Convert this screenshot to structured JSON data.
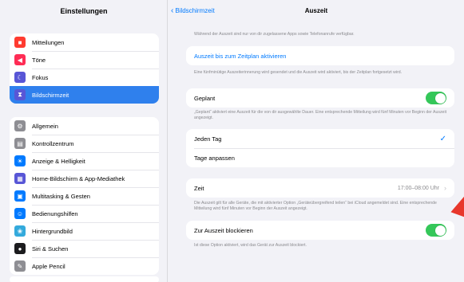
{
  "sidebar": {
    "title": "Einstellungen",
    "group1": [
      {
        "label": "Mitteilungen",
        "icon": "bell-icon",
        "glyph": "■",
        "color": "#ff3b30"
      },
      {
        "label": "Töne",
        "icon": "speaker-icon",
        "glyph": "◀",
        "color": "#ff2d55"
      },
      {
        "label": "Fokus",
        "icon": "moon-icon",
        "glyph": "☾",
        "color": "#5856d6"
      },
      {
        "label": "Bildschirmzeit",
        "icon": "hourglass-icon",
        "glyph": "⧗",
        "color": "#5856d6",
        "active": true
      }
    ],
    "group2": [
      {
        "label": "Allgemein",
        "icon": "gear-icon",
        "glyph": "⚙",
        "color": "#8e8e93"
      },
      {
        "label": "Kontrollzentrum",
        "icon": "control-center-icon",
        "glyph": "▤",
        "color": "#8e8e93"
      },
      {
        "label": "Anzeige & Helligkeit",
        "icon": "sun-icon",
        "glyph": "☀",
        "color": "#007aff"
      },
      {
        "label": "Home-Bildschirm & App-Mediathek",
        "icon": "home-grid-icon",
        "glyph": "▦",
        "color": "#5856d6"
      },
      {
        "label": "Multitasking & Gesten",
        "icon": "multitasking-icon",
        "glyph": "▣",
        "color": "#007aff"
      },
      {
        "label": "Bedienungshilfen",
        "icon": "accessibility-icon",
        "glyph": "☺",
        "color": "#007aff"
      },
      {
        "label": "Hintergrundbild",
        "icon": "wallpaper-icon",
        "glyph": "❀",
        "color": "#34aadc"
      },
      {
        "label": "Siri & Suchen",
        "icon": "siri-icon",
        "glyph": "●",
        "color": "#1c1c1e"
      },
      {
        "label": "Apple Pencil",
        "icon": "pencil-icon",
        "glyph": "✎",
        "color": "#8e8e93"
      }
    ]
  },
  "main": {
    "back_label": "Bildschirmzeit",
    "title": "Auszeit",
    "intro_note": "Während der Auszeit sind nur von dir zugelassene Apps sowie Telefonanrufe verfügbar.",
    "schedule_link": "Auszeit bis zum Zeitplan aktivieren",
    "schedule_note": "Eine fünfminütige Auszeiterinnerung wird gesendet und die Auszeit wird aktiviert, bis der Zeitplan fortgesetzt wird.",
    "planned_label": "Geplant",
    "planned_on": true,
    "planned_note": "„Geplant“ aktiviert eine Auszeit für die von dir ausgewählte Dauer. Eine entsprechende Mitteilung wird fünf Minuten vor Beginn der Auszeit angezeigt.",
    "every_day_label": "Jeden Tag",
    "every_day_checked": true,
    "customize_days_label": "Tage anpassen",
    "time_label": "Zeit",
    "time_value": "17:00–08:00 Uhr",
    "time_note": "Die Auszeit gilt für alle Geräte, die mit aktivierter Option „Geräteübergreifend teilen“ bei iCloud angemeldet sind. Eine entsprechende Mitteilung wird fünf Minuten vor Beginn der Auszeit angezeigt.",
    "block_label": "Zur Auszeit blockieren",
    "block_on": true,
    "block_note": "Ist diese Option aktiviert, wird das Gerät zur Auszeit blockiert."
  },
  "colors": {
    "accent": "#007aff",
    "toggle_on": "#34c759",
    "sidebar_active": "#2f80ed",
    "pointer": "#e8372c"
  }
}
